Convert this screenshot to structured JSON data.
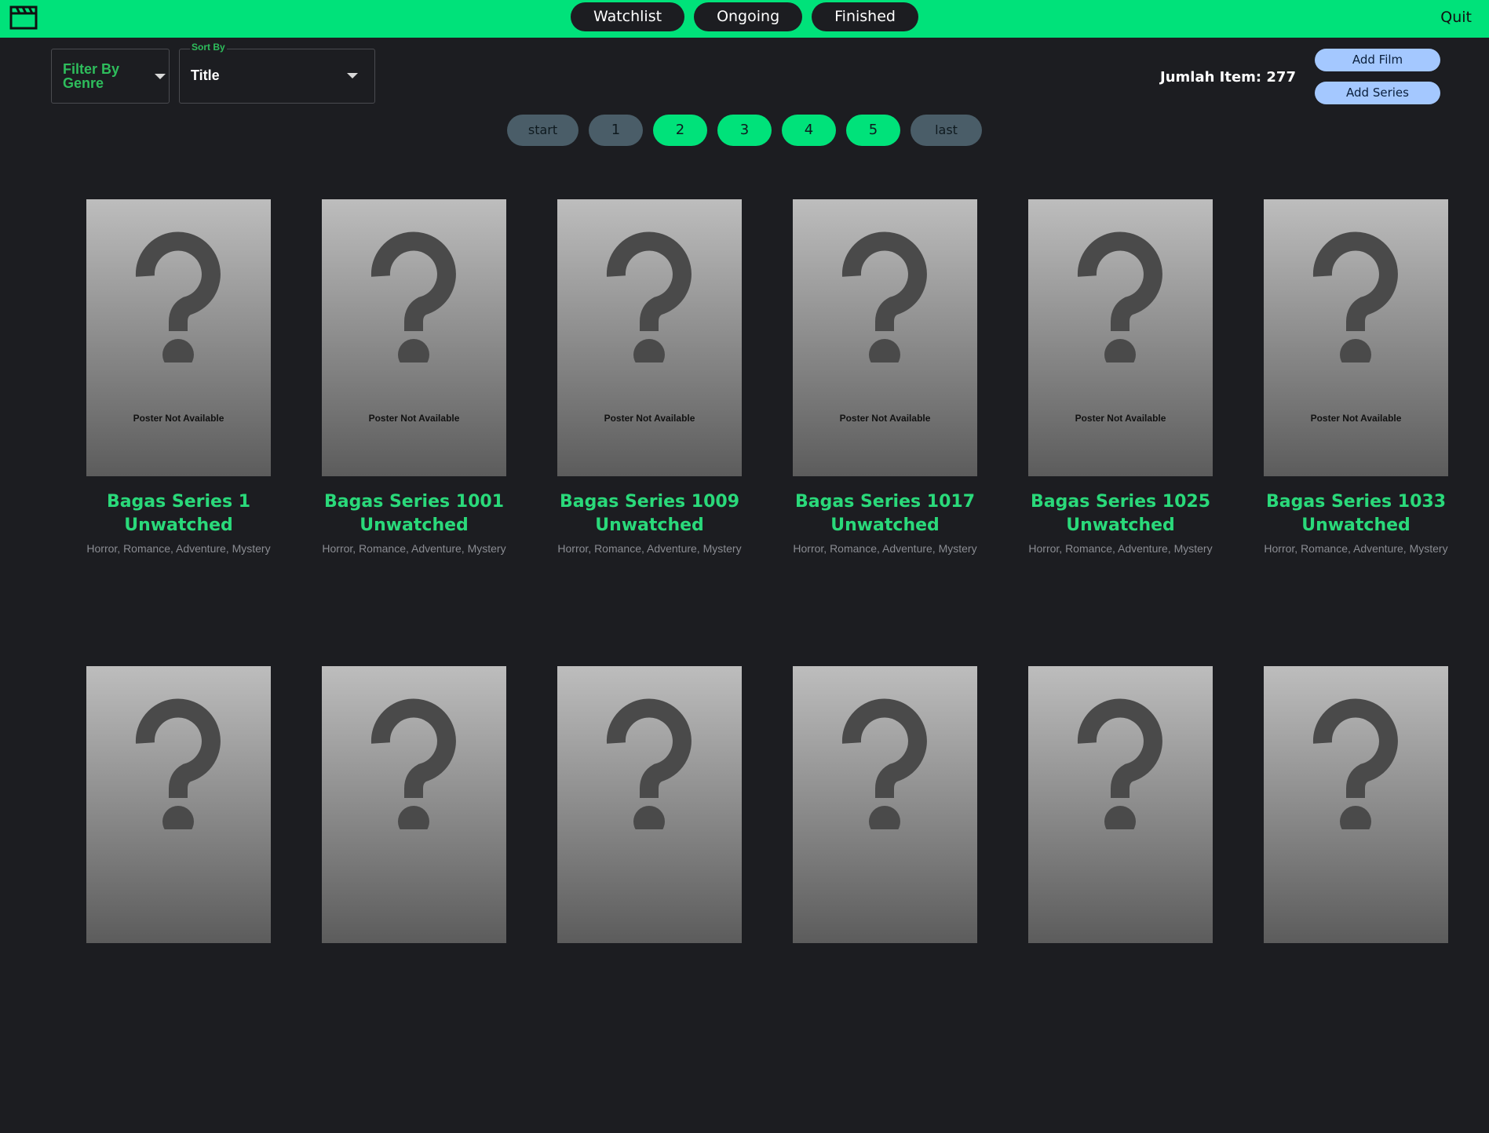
{
  "colors": {
    "accent": "#00e27a",
    "background": "#1c1d21",
    "pager_dark": "#4a5d68",
    "add_button": "#a4c8ff",
    "title_green": "#2ad97a"
  },
  "header": {
    "logo_icon": "clapperboard-icon",
    "nav": [
      "Watchlist",
      "Ongoing",
      "Finished"
    ],
    "quit_label": "Quit"
  },
  "controls": {
    "filter_label": "Filter By Genre",
    "sort_legend": "Sort By",
    "sort_value": "Title",
    "count_text": "Jumlah Item: 277",
    "add_film_label": "Add Film",
    "add_series_label": "Add Series"
  },
  "pagination": {
    "start_label": "start",
    "pages": [
      "1",
      "2",
      "3",
      "4",
      "5"
    ],
    "current_page": "1",
    "last_label": "last"
  },
  "cards": [
    {
      "title": "Bagas Series 1",
      "status": "Unwatched",
      "genres": "Horror, Romance, Adventure, Mystery",
      "poster_text": "Poster Not Available"
    },
    {
      "title": "Bagas Series 1001",
      "status": "Unwatched",
      "genres": "Horror, Romance, Adventure, Mystery",
      "poster_text": "Poster Not Available"
    },
    {
      "title": "Bagas Series 1009",
      "status": "Unwatched",
      "genres": "Horror, Romance, Adventure, Mystery",
      "poster_text": "Poster Not Available"
    },
    {
      "title": "Bagas Series 1017",
      "status": "Unwatched",
      "genres": "Horror, Romance, Adventure, Mystery",
      "poster_text": "Poster Not Available"
    },
    {
      "title": "Bagas Series 1025",
      "status": "Unwatched",
      "genres": "Horror, Romance, Adventure, Mystery",
      "poster_text": "Poster Not Available"
    },
    {
      "title": "Bagas Series 1033",
      "status": "Unwatched",
      "genres": "Horror, Romance, Adventure, Mystery",
      "poster_text": "Poster Not Available"
    }
  ]
}
